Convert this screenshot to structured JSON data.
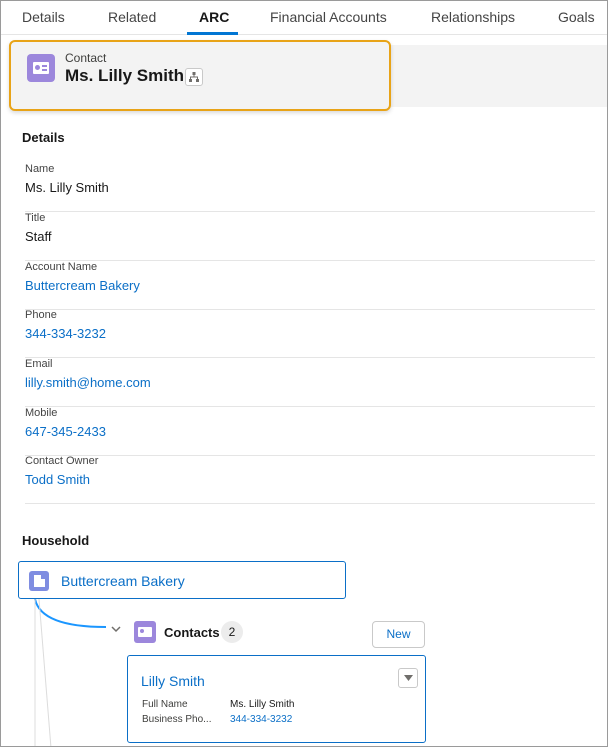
{
  "tabs": [
    {
      "label": "Details"
    },
    {
      "label": "Related"
    },
    {
      "label": "ARC",
      "active": true
    },
    {
      "label": "Financial Accounts"
    },
    {
      "label": "Relationships"
    },
    {
      "label": "Goals"
    }
  ],
  "header": {
    "object_type": "Contact",
    "record_name": "Ms. Lilly Smith",
    "icon": "contact-card-icon",
    "hierarchy_icon": "hierarchy-icon"
  },
  "details": {
    "title": "Details",
    "fields": [
      {
        "label": "Name",
        "value": "Ms. Lilly Smith",
        "link": false
      },
      {
        "label": "Title",
        "value": "Staff",
        "link": false
      },
      {
        "label": "Account Name",
        "value": "Buttercream Bakery",
        "link": true
      },
      {
        "label": "Phone",
        "value": "344-334-3232",
        "link": true
      },
      {
        "label": "Email",
        "value": "lilly.smith@home.com",
        "link": true
      },
      {
        "label": "Mobile",
        "value": "647-345-2433",
        "link": true
      },
      {
        "label": "Contact Owner",
        "value": "Todd Smith",
        "link": true
      }
    ]
  },
  "household": {
    "title": "Household",
    "account": {
      "name": "Buttercream Bakery",
      "icon": "account-building-icon"
    },
    "contacts": {
      "label": "Contacts",
      "count": "2",
      "new_label": "New",
      "icon": "contact-card-icon",
      "card": {
        "name": "Lilly Smith",
        "rows": [
          {
            "label": "Full Name",
            "value": "Ms. Lilly Smith",
            "link": false
          },
          {
            "label": "Business Pho...",
            "value": "344-334-3232",
            "link": true
          }
        ]
      }
    }
  },
  "colors": {
    "accent": "#0b6fc7",
    "highlight_border": "#e8a317",
    "contact_icon": "#9c87dc",
    "account_icon": "#7f8de1"
  }
}
